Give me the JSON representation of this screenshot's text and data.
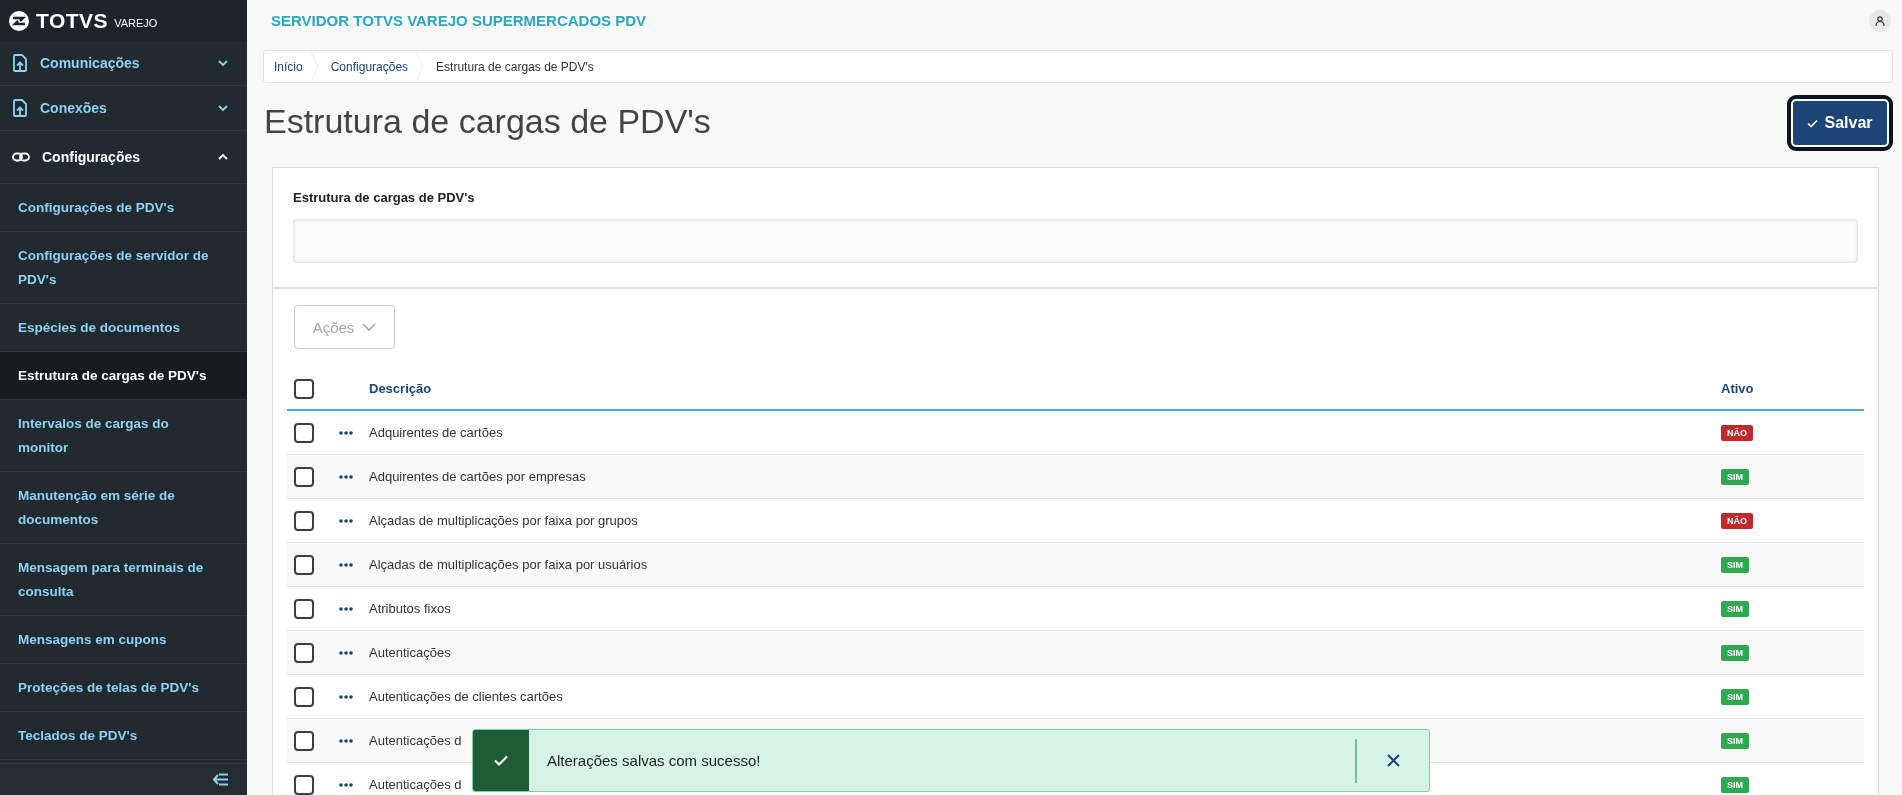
{
  "sidebar": {
    "logo": {
      "brand": "TOTVS",
      "product": "VAREJO"
    },
    "groups": [
      {
        "label": "Comunicações",
        "expanded": false
      },
      {
        "label": "Conexões",
        "expanded": false
      },
      {
        "label": "Configurações",
        "expanded": true,
        "children": [
          {
            "label": "Configurações de PDV's",
            "selected": false
          },
          {
            "label": "Configurações de servidor de PDV's",
            "selected": false
          },
          {
            "label": "Espécies de documentos",
            "selected": false
          },
          {
            "label": "Estrutura de cargas de PDV's",
            "selected": true
          },
          {
            "label": "Intervalos de cargas do monitor",
            "selected": false
          },
          {
            "label": "Manutenção em série de documentos",
            "selected": false
          },
          {
            "label": "Mensagem para terminais de consulta",
            "selected": false
          },
          {
            "label": "Mensagens em cupons",
            "selected": false
          },
          {
            "label": "Proteções de telas de PDV's",
            "selected": false
          },
          {
            "label": "Teclados de PDV's",
            "selected": false
          }
        ]
      }
    ]
  },
  "header": {
    "title": "SERVIDOR TOTVS VAREJO SUPERMERCADOS PDV"
  },
  "breadcrumb": [
    "Início",
    "Configurações",
    "Estrutura de cargas de PDV's"
  ],
  "page_title": "Estrutura de cargas de PDV's",
  "save_button": "Salvar",
  "form": {
    "label": "Estrutura de cargas de PDV's"
  },
  "actions_button": {
    "label": "Ações",
    "disabled": true
  },
  "table": {
    "columns": [
      "Descrição",
      "Ativo"
    ],
    "select_all_checked": false,
    "rows": [
      {
        "checked": false,
        "description": "Adquirentes de cartões",
        "active": false,
        "status": "NÃO"
      },
      {
        "checked": false,
        "description": "Adquirentes de cartões por empresas",
        "active": true,
        "status": "SIM"
      },
      {
        "checked": false,
        "description": "Alçadas de multiplicações por faixa por grupos",
        "active": false,
        "status": "NÃO"
      },
      {
        "checked": false,
        "description": "Alçadas de multiplicações por faixa por usuários",
        "active": true,
        "status": "SIM"
      },
      {
        "checked": false,
        "description": "Atributos fixos",
        "active": true,
        "status": "SIM"
      },
      {
        "checked": false,
        "description": "Autenticações",
        "active": true,
        "status": "SIM"
      },
      {
        "checked": false,
        "description": "Autenticações de clientes cartões",
        "active": true,
        "status": "SIM"
      },
      {
        "checked": false,
        "description": "Autenticações d",
        "active": true,
        "status": "SIM"
      },
      {
        "checked": false,
        "description": "Autenticações d",
        "active": true,
        "status": "SIM"
      }
    ]
  },
  "toast": {
    "kind": "success",
    "message": "Alterações salvas com sucesso!"
  }
}
